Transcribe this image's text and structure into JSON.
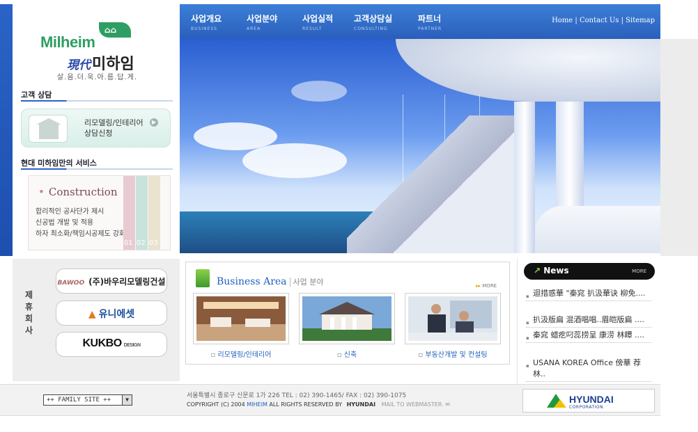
{
  "logo": {
    "en": "Milheim",
    "hanja": "現代",
    "kr": "미하임",
    "slogan": "살.음.더.욱.아.름.답.게."
  },
  "left": {
    "consult_title": "고객 상담",
    "consult_line1": "리모델링/인테리어",
    "consult_line2": "상담신청",
    "service_title": "현대 미하임만의 서비스",
    "service_heading": "Construction",
    "service_lines": [
      "합리적인 공사단가 제시",
      "신공법 개발 및 적용",
      "하자 최소화/책임시공제도 강화"
    ],
    "stripe_numbers": [
      "01",
      "02",
      "03"
    ]
  },
  "nav": {
    "items": [
      {
        "kr": "사업개요",
        "en": "BUSINESS"
      },
      {
        "kr": "사업분야",
        "en": "AREA"
      },
      {
        "kr": "사업실적",
        "en": "RESULT"
      },
      {
        "kr": "고객상담실",
        "en": "CONSULTING"
      },
      {
        "kr": "파트너",
        "en": "PARTNER"
      }
    ],
    "util": [
      "Home",
      "Contact Us",
      "Sitemap"
    ]
  },
  "partners": {
    "label": "제휴회사",
    "items": [
      "(주)바우리모델링건설",
      "유니에셋",
      "KUKBO"
    ],
    "kukbo_sub": "DESIGN"
  },
  "business": {
    "title": "Business Area",
    "title_kr": "사업 분야",
    "more": "MORE",
    "captions": [
      "리모델링/인테리어",
      "신축",
      "부동산개발 및 컨설팅"
    ]
  },
  "news": {
    "title": "News",
    "more": "MORE",
    "items": [
      "迴措惑華 \"秦窕 扒汲華诀 柳免....",
      "扒汲版扁 混酒唱唱..眉皑版扁 ....",
      "秦窕 蜡疙叼蕊捞呈 康涝 林瞫 ....",
      "USANA KOREA Office 傍華 荐林.."
    ]
  },
  "footer": {
    "family_site": "++ FAMILY SITE ++",
    "address": "서울특별시 종로구 신문로 1가 226 TEL : 02) 390-1465/ FAX : 02) 390-1075",
    "copyright_pre": "COPYRIGHT (C) 2004",
    "copyright_brand": "MIHEIM",
    "copyright_post": "ALL RIGHTS RESERVED BY",
    "copyright_hd": "HYUNDAI",
    "mail": "MAIL TO WEBMASTER.",
    "hyundai_name": "HYUNDAI",
    "hyundai_corp": "CORPORATION"
  },
  "colors": {
    "nav_blue": "#2a5fbb",
    "brand_green": "#2f9e62",
    "link_blue": "#1f5fbf"
  }
}
